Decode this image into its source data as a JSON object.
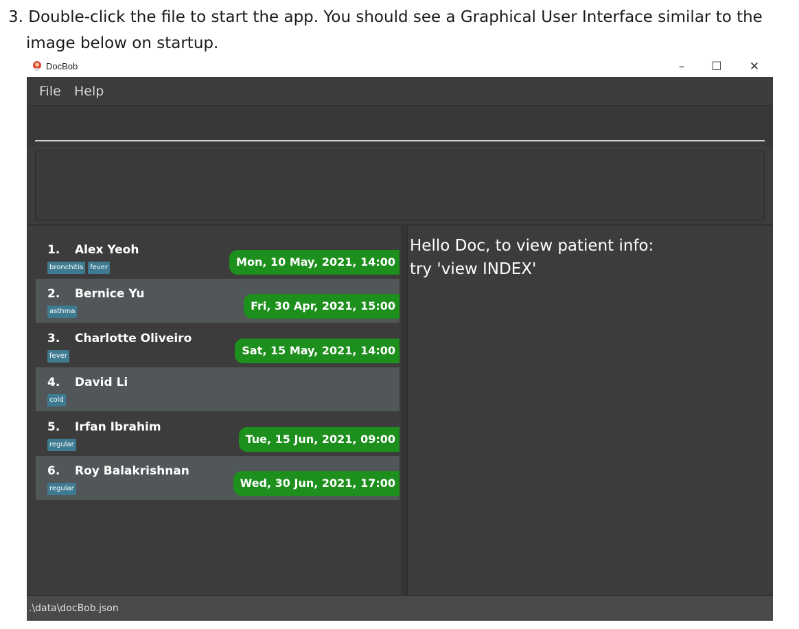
{
  "instructions": {
    "line1": "3. Double-click the file to start the app. You should see a Graphical User Interface similar to the",
    "line2": "image below on startup."
  },
  "window": {
    "title": "DocBob",
    "minimize": "–",
    "maximize": "☐",
    "close": "✕"
  },
  "menu": {
    "file": "File",
    "help": "Help"
  },
  "command_box": {
    "value": ""
  },
  "patients": [
    {
      "index": "1.",
      "name": "Alex Yeoh",
      "tags": [
        "bronchitis",
        "fever"
      ],
      "appointment": "Mon, 10 May, 2021, 14:00"
    },
    {
      "index": "2.",
      "name": "Bernice Yu",
      "tags": [
        "asthma"
      ],
      "appointment": "Fri, 30 Apr, 2021, 15:00"
    },
    {
      "index": "3.",
      "name": "Charlotte Oliveiro",
      "tags": [
        "fever"
      ],
      "appointment": "Sat, 15 May, 2021, 14:00"
    },
    {
      "index": "4.",
      "name": "David Li",
      "tags": [
        "cold"
      ],
      "appointment": ""
    },
    {
      "index": "5.",
      "name": "Irfan Ibrahim",
      "tags": [
        "regular"
      ],
      "appointment": "Tue, 15 Jun, 2021, 09:00"
    },
    {
      "index": "6.",
      "name": "Roy Balakrishnan",
      "tags": [
        "regular"
      ],
      "appointment": "Wed, 30 Jun, 2021, 17:00"
    }
  ],
  "detail": {
    "line1": "Hello Doc, to view patient info:",
    "line2": "try 'view INDEX'"
  },
  "status": {
    "path": ".\\data\\docBob.json"
  },
  "colors": {
    "background": "#3c3c3c",
    "row_alt": "#515658",
    "tag": "#3e7b91",
    "appointment": "#1d8f1d"
  }
}
